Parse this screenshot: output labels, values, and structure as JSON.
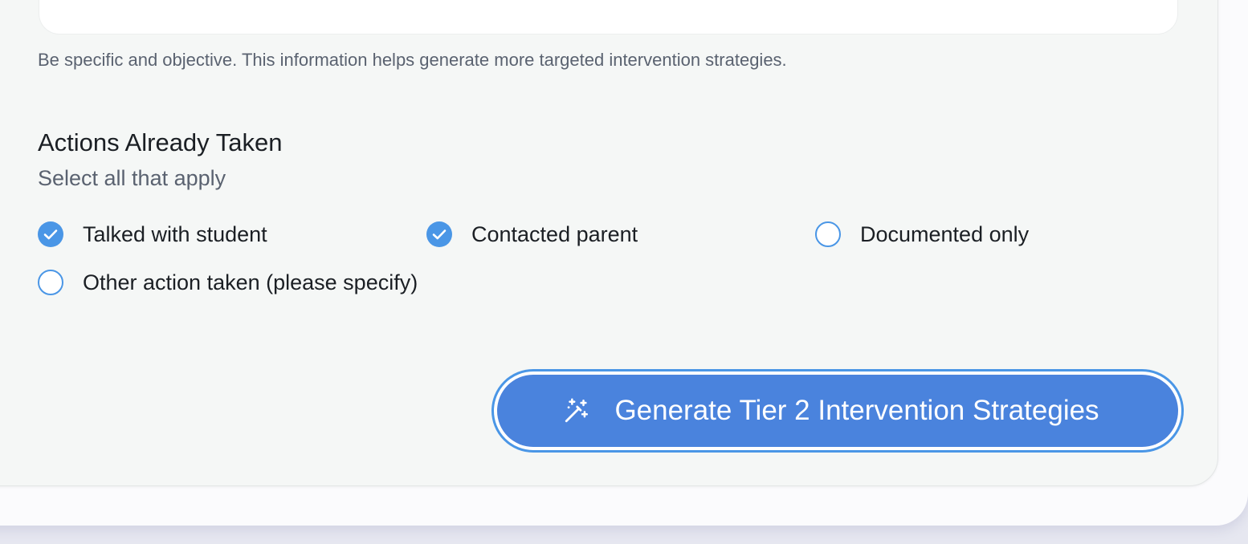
{
  "help_text": "Be specific and objective. This information helps generate more targeted intervention strategies.",
  "actions": {
    "title": "Actions Already Taken",
    "subtitle": "Select all that apply",
    "options": [
      {
        "label": "Talked with student",
        "checked": true
      },
      {
        "label": "Contacted parent",
        "checked": true
      },
      {
        "label": "Documented only",
        "checked": false
      },
      {
        "label": "Other action taken (please specify)",
        "checked": false
      }
    ]
  },
  "generate_button": {
    "label": "Generate Tier 2 Intervention Strategies",
    "icon": "magic-wand-icon"
  },
  "colors": {
    "accent": "#4a96e6",
    "button_fill": "#4a83dd",
    "panel_bg": "#f5f7f6"
  }
}
